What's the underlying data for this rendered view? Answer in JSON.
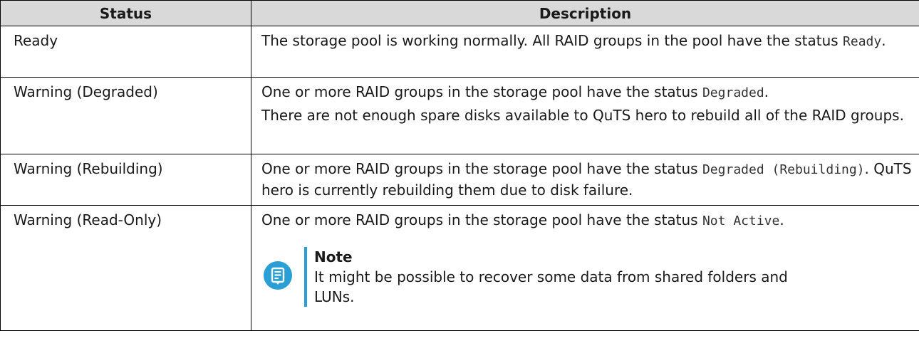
{
  "table": {
    "headers": [
      "Status",
      "Description"
    ],
    "rows": [
      {
        "status": "Ready",
        "desc_text": "The storage pool is working normally. All RAID groups in the pool have the status ",
        "desc_code": "Ready",
        "desc_end": "."
      },
      {
        "status": "Warning (Degraded)",
        "desc_text": "One or more RAID groups in the storage pool have the status ",
        "desc_code": "Degraded",
        "desc_end": ".",
        "desc_extra": "There are not enough spare disks available to QuTS hero to rebuild all of the RAID groups."
      },
      {
        "status": "Warning (Rebuilding)",
        "desc_text": "One or more RAID groups in the storage pool have the status ",
        "desc_code": "Degraded (Rebuilding)",
        "desc_end": ". QuTS hero is currently rebuilding them due to disk failure."
      },
      {
        "status": "Warning (Read-Only)",
        "desc_text": "One or more RAID groups in the storage pool have the status ",
        "desc_code": "Not Active",
        "desc_end": ".",
        "note": {
          "title": "Note",
          "text": "It might be possible to recover some data from shared folders and LUNs.",
          "icon": "note-icon",
          "accent": "#2a9fd6"
        }
      }
    ]
  }
}
